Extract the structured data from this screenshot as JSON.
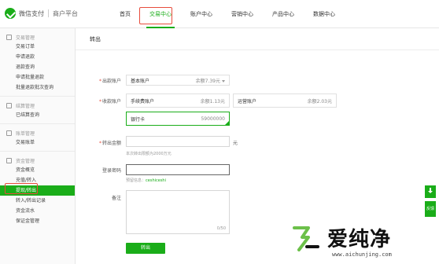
{
  "brand": {
    "name": "微信支付",
    "sub": "商户平台"
  },
  "nav": {
    "items": [
      {
        "label": "首页"
      },
      {
        "label": "交易中心"
      },
      {
        "label": "账户中心"
      },
      {
        "label": "营销中心"
      },
      {
        "label": "产品中心"
      },
      {
        "label": "数据中心"
      }
    ],
    "active_index": 1
  },
  "sidebar": {
    "groups": [
      {
        "title": "交易管理",
        "items": [
          "交易订单",
          "申请退款",
          "退款查询",
          "申请批量退款",
          "批量退款批次查询"
        ]
      },
      {
        "title": "结算管理",
        "items": [
          "已结算查询"
        ]
      },
      {
        "title": "账单管理",
        "items": [
          "交易账单"
        ]
      },
      {
        "title": "资金管理",
        "items": [
          "资金概览",
          "充值/转入",
          "提现/转出",
          "转入/转出记录",
          "资金流水",
          "保证金管理"
        ]
      }
    ],
    "active_item": "提现/转出"
  },
  "page": {
    "title": "转出"
  },
  "form": {
    "out_account": {
      "label": "出款账户",
      "name": "基本账户",
      "balance": "余额7.39元"
    },
    "in_account": {
      "label": "收款账户",
      "options": [
        {
          "name": "手续费账户",
          "balance": "余额1.13元"
        },
        {
          "name": "运营账户",
          "balance": "余额2.03元"
        },
        {
          "name": "银行卡",
          "balance": "59000000"
        }
      ],
      "selected": "银行卡"
    },
    "amount": {
      "label": "转出金额",
      "unit": "元",
      "hint": "本次转出限额为2000万元"
    },
    "password": {
      "label": "登录密码",
      "hint_prefix": "预留信息：",
      "hint_value": "ceshiceshi"
    },
    "remark": {
      "label": "备注",
      "counter": "0/50"
    },
    "submit_label": "转出"
  },
  "float": {
    "download_label": "",
    "feedback_label": "反馈"
  },
  "watermark": {
    "title": "爱纯净",
    "url": "www.aichunjing.com"
  },
  "colors": {
    "accent": "#1aad19",
    "highlight": "#e74c3c"
  }
}
